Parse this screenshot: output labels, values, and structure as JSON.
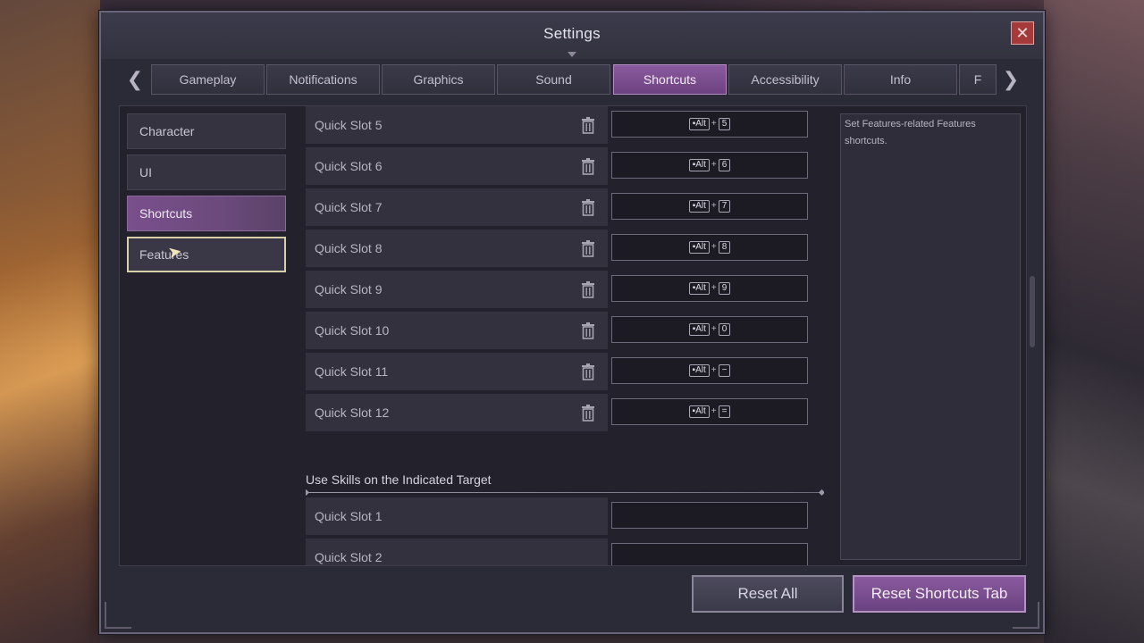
{
  "window": {
    "title": "Settings",
    "close_label": "✕"
  },
  "tabs": [
    {
      "label": "Gameplay",
      "active": false
    },
    {
      "label": "Notifications",
      "active": false
    },
    {
      "label": "Graphics",
      "active": false
    },
    {
      "label": "Sound",
      "active": false
    },
    {
      "label": "Shortcuts",
      "active": true
    },
    {
      "label": "Accessibility",
      "active": false
    },
    {
      "label": "Info",
      "active": false
    },
    {
      "label": "F",
      "active": false
    }
  ],
  "sidebar": {
    "items": [
      {
        "label": "Character"
      },
      {
        "label": "UI"
      },
      {
        "label": "Shortcuts"
      },
      {
        "label": "Features"
      }
    ]
  },
  "shortcuts": [
    {
      "label": "Quick Slot 5",
      "modifier": "Alt",
      "key": "5"
    },
    {
      "label": "Quick Slot 6",
      "modifier": "Alt",
      "key": "6"
    },
    {
      "label": "Quick Slot 7",
      "modifier": "Alt",
      "key": "7"
    },
    {
      "label": "Quick Slot 8",
      "modifier": "Alt",
      "key": "8"
    },
    {
      "label": "Quick Slot 9",
      "modifier": "Alt",
      "key": "9"
    },
    {
      "label": "Quick Slot 10",
      "modifier": "Alt",
      "key": "0"
    },
    {
      "label": "Quick Slot 11",
      "modifier": "Alt",
      "key": "−"
    },
    {
      "label": "Quick Slot 12",
      "modifier": "Alt",
      "key": "="
    }
  ],
  "target_section": {
    "title": "Use Skills on the Indicated Target",
    "rows": [
      {
        "label": "Quick Slot 1"
      },
      {
        "label": "Quick Slot 2"
      }
    ]
  },
  "description": {
    "text": "Set Features-related Features shortcuts."
  },
  "buttons": {
    "reset_all": "Reset All",
    "reset_tab": "Reset Shortcuts Tab"
  },
  "colors": {
    "accent": "#7a4f8c",
    "panel": "#2b2a37",
    "close": "#a43a3a"
  }
}
